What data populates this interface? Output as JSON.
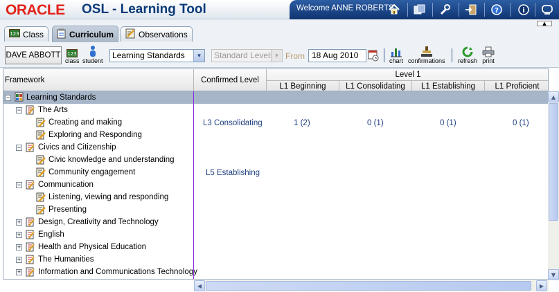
{
  "header": {
    "logo": "ORACLE",
    "app_title": "OSL - Learning Tool",
    "welcome": "Welcome ANNE ROBERTS"
  },
  "tabs": [
    {
      "label": "Class",
      "icon": "class-icon"
    },
    {
      "label": "Curriculum",
      "icon": "curriculum-icon"
    },
    {
      "label": "Observations",
      "icon": "observations-icon"
    }
  ],
  "toolbar": {
    "user": "DAVE ABBOTT",
    "class_label": "class",
    "student_label": "student",
    "framework_select": "Learning Standards",
    "levels_select": "Standard Levels",
    "from_label": "From",
    "from_date": "18 Aug 2010",
    "chart_label": "chart",
    "confirmations_label": "confirmations",
    "refresh_label": "refresh",
    "print_label": "print"
  },
  "grid": {
    "framework_header": "Framework",
    "confirmed_header": "Confirmed Level",
    "group_header": "Level 1",
    "level_headers": [
      "L1 Beginning",
      "L1 Consolidating",
      "L1 Establishing",
      "L1 Proficient"
    ],
    "root": "Learning Standards",
    "tree": [
      {
        "label": "The Arts",
        "expanded": true
      },
      {
        "label": "Creating and making",
        "child": true
      },
      {
        "label": "Exploring and Responding",
        "child": true
      },
      {
        "label": "Civics and Citizenship",
        "expanded": true
      },
      {
        "label": "Civic knowledge and understanding",
        "child": true
      },
      {
        "label": "Community engagement",
        "child": true
      },
      {
        "label": "Communication",
        "expanded": true
      },
      {
        "label": "Listening, viewing and responding",
        "child": true
      },
      {
        "label": "Presenting",
        "child": true
      },
      {
        "label": "Design, Creativity and Technology",
        "expanded": false
      },
      {
        "label": "English",
        "expanded": false
      },
      {
        "label": "Health and Physical Education",
        "expanded": false
      },
      {
        "label": "The Humanities",
        "expanded": false
      },
      {
        "label": "Information and Communications Technology",
        "expanded": false
      }
    ],
    "row_arts": {
      "confirmed": "L3 Consolidating",
      "values": [
        "1 (2)",
        "0 (1)",
        "0 (1)",
        "0 (1)"
      ]
    },
    "row_civics": {
      "confirmed": "L5 Establishing"
    }
  },
  "colors": {
    "oracle_red": "#e2231a",
    "title_blue": "#0b3a78",
    "navbar": "#1a4485",
    "root_row": "#a7b5c9",
    "link_blue": "#1e3f80",
    "divider": "#8a2be2"
  }
}
